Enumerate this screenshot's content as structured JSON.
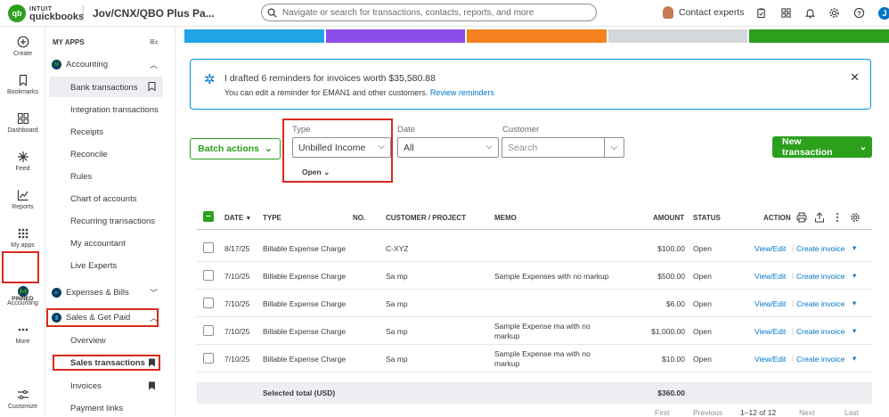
{
  "app": {
    "logo_brand": "INTUIT",
    "logo_product": "quickbooks",
    "logo_mark": "qb",
    "company": "Jov/CNX/QBO Plus Pa...",
    "search_placeholder": "Navigate or search for transactions, contacts, reports, and more",
    "contact_experts": "Contact experts",
    "user_initial": "J"
  },
  "rail": {
    "items": [
      {
        "label": "Create",
        "icon": "plus-circle-icon"
      },
      {
        "label": "Bookmarks",
        "icon": "bookmark-icon"
      },
      {
        "label": "Dashboard",
        "icon": "dashboard-icon"
      },
      {
        "label": "Feed",
        "icon": "feed-icon"
      },
      {
        "label": "Reports",
        "icon": "reports-icon"
      },
      {
        "label": "My apps",
        "icon": "grid-icon"
      },
      {
        "label": "Accounting",
        "icon": "accounting-icon"
      },
      {
        "label": "More",
        "icon": "more-icon"
      },
      {
        "label": "Customize",
        "icon": "customize-icon"
      }
    ],
    "pinned": "PINNED"
  },
  "nav": {
    "title": "MY APPS",
    "accounting": "Accounting",
    "accounting_items": [
      "Bank transactions",
      "Integration transactions",
      "Receipts",
      "Reconcile",
      "Rules",
      "Chart of accounts",
      "Recurring transactions",
      "My accountant",
      "Live Experts"
    ],
    "expenses": "Expenses & Bills",
    "sales": "Sales & Get Paid",
    "sales_items": [
      "Overview",
      "Sales transactions",
      "Invoices",
      "Payment links"
    ]
  },
  "colors": {
    "bars": [
      "#21a4e6",
      "#8c4de8",
      "#f58220",
      "#d4d7dc",
      "#2ca01c"
    ],
    "accent": "#2ca01c",
    "link": "#0077c5",
    "highlight": "#d52b1e"
  },
  "alert": {
    "title": "I drafted 6 reminders for invoices worth $35,580.88",
    "body": "You can edit a reminder for EMAN1 and other customers.",
    "link": "Review reminders"
  },
  "toolbar": {
    "batch_actions": "Batch actions",
    "type_label": "Type",
    "type_value": "Unbilled Income",
    "date_label": "Date",
    "date_value": "All",
    "customer_label": "Customer",
    "customer_placeholder": "Search",
    "status_value": "Open",
    "new_transaction": "New transaction"
  },
  "table": {
    "headers": [
      "DATE",
      "TYPE",
      "NO.",
      "CUSTOMER / PROJECT",
      "MEMO",
      "AMOUNT",
      "STATUS",
      "ACTION"
    ],
    "date_sort_indicator": "▼",
    "rows": [
      {
        "date": "8/17/25",
        "type": "Billable Expense Charge",
        "no": "",
        "customer": "C-XYZ",
        "memo": "",
        "amount": "$100.00",
        "status": "Open",
        "action1": "View/Edit",
        "action2": "Create invoice"
      },
      {
        "date": "7/10/25",
        "type": "Billable Expense Charge",
        "no": "",
        "customer": "Sa mp",
        "memo": "Sample Expenses with no markup",
        "amount": "$500.00",
        "status": "Open",
        "action1": "View/Edit",
        "action2": "Create invoice"
      },
      {
        "date": "7/10/25",
        "type": "Billable Expense Charge",
        "no": "",
        "customer": "Sa mp",
        "memo": "",
        "amount": "$6.00",
        "status": "Open",
        "action1": "View/Edit",
        "action2": "Create invoice"
      },
      {
        "date": "7/10/25",
        "type": "Billable Expense Charge",
        "no": "",
        "customer": "Sa mp",
        "memo": "Sample Expense ma with no markup",
        "amount": "$1,000.00",
        "status": "Open",
        "action1": "View/Edit",
        "action2": "Create invoice"
      },
      {
        "date": "7/10/25",
        "type": "Billable Expense Charge",
        "no": "",
        "customer": "Sa mp",
        "memo": "Sample Expense ma with no markup",
        "amount": "$10.00",
        "status": "Open",
        "action1": "View/Edit",
        "action2": "Create invoice"
      }
    ],
    "total_label": "Selected total (USD)",
    "total_value": "$360.00"
  },
  "pager": {
    "first": "First",
    "previous": "Previous",
    "range": "1–12 of 12",
    "next": "Next",
    "last": "Last"
  }
}
